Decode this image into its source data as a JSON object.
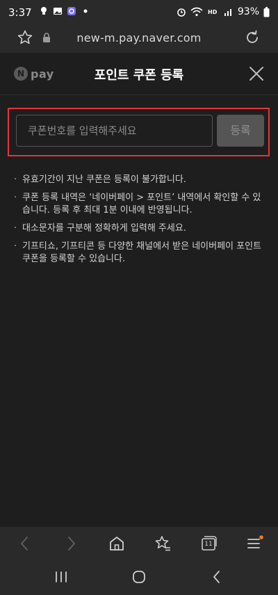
{
  "status": {
    "time": "3:37",
    "battery": "93%"
  },
  "browser": {
    "url": "new-m.pay.naver.com"
  },
  "header": {
    "logo_letter": "N",
    "logo_word": "pay",
    "title": "포인트 쿠폰 등록"
  },
  "coupon": {
    "placeholder": "쿠폰번호를 입력해주세요",
    "register_label": "등록"
  },
  "notices": [
    "유효기간이 지난 쿠폰은 등록이 불가합니다.",
    "쿠폰 등록 내역은 ‘네이버페이 > 포인트’ 내역에서 확인할 수 있습니다. 등록 후 최대 1분 이내에 반영됩니다.",
    "대소문자를 구분해 정확하게 입력해 주세요.",
    "기프티쇼, 기프티콘 등 다양한 채널에서 받은 네이버페이 포인트 쿠폰을 등록할 수 있습니다."
  ],
  "nav": {
    "tabs_count": "11"
  },
  "colors": {
    "background": "#1e1e1e",
    "highlight_border": "#e8323c",
    "button_bg": "#555555",
    "notification_dot": "#f07b28"
  }
}
